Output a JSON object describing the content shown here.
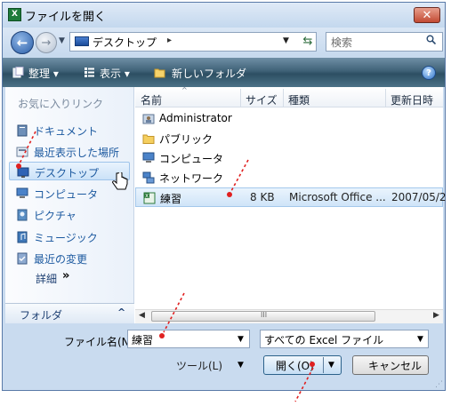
{
  "window": {
    "title": "ファイルを開く",
    "title_icon": "excel-icon",
    "close_label": "✕"
  },
  "address_bar": {
    "location": "デスクトップ",
    "separator": "▸",
    "search_placeholder": "検索"
  },
  "toolbar": {
    "organize_label": "整理",
    "views_label": "表示",
    "new_folder_label": "新しいフォルダ",
    "help_label": "?"
  },
  "navigation": {
    "header": "お気に入りリンク",
    "items": [
      {
        "label": "ドキュメント",
        "icon": "documents-icon"
      },
      {
        "label": "最近表示した場所",
        "icon": "recent-places-icon"
      },
      {
        "label": "デスクトップ",
        "icon": "desktop-icon",
        "selected": true
      },
      {
        "label": "コンピュータ",
        "icon": "computer-icon"
      },
      {
        "label": "ピクチャ",
        "icon": "pictures-icon"
      },
      {
        "label": "ミュージック",
        "icon": "music-icon"
      },
      {
        "label": "最近の変更",
        "icon": "recently-changed-icon"
      }
    ],
    "more_label": "詳細",
    "more_arrow": "»",
    "folders_label": "フォルダ",
    "folders_chevron": "^"
  },
  "file_list": {
    "columns": [
      "名前",
      "サイズ",
      "種類",
      "更新日時"
    ],
    "rows": [
      {
        "name": "Administrator",
        "size": "",
        "type": "",
        "date": "",
        "icon": "user-folder-icon"
      },
      {
        "name": "パブリック",
        "size": "",
        "type": "",
        "date": "",
        "icon": "folder-icon"
      },
      {
        "name": "コンピュータ",
        "size": "",
        "type": "",
        "date": "",
        "icon": "computer-icon"
      },
      {
        "name": "ネットワーク",
        "size": "",
        "type": "",
        "date": "",
        "icon": "network-icon"
      },
      {
        "name": "練習",
        "size": "8 KB",
        "type": "Microsoft Office ...",
        "date": "2007/05/2",
        "icon": "excel-file-icon",
        "selected": true
      }
    ],
    "scroll_grip": "III"
  },
  "footer": {
    "filename_label": "ファイル名(N):",
    "filename_value": "練習",
    "filetype_value": "すべての Excel ファイル",
    "tools_label": "ツール(L)",
    "open_label": "開く(O)",
    "cancel_label": "キャンセル"
  },
  "colors": {
    "toolbar": "#3f6277",
    "selection": "#cbe2f8",
    "annotation": "#e02020"
  }
}
